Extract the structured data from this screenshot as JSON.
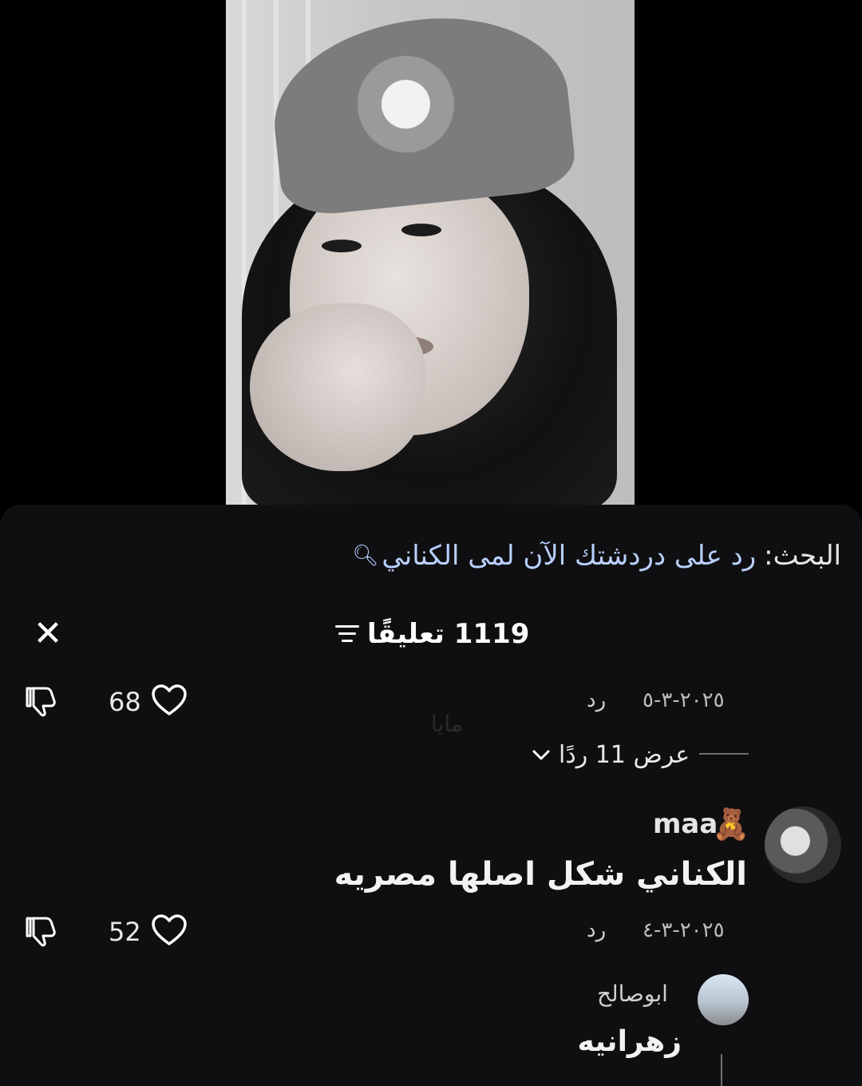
{
  "search": {
    "label": "البحث:",
    "query": "رد على دردشتك الآن لمى الكناني",
    "icon": "search-icon"
  },
  "header": {
    "comments_count": "1119 تعليقًا",
    "filter_icon": "filter-icon",
    "close_icon": "close-icon"
  },
  "comments": [
    {
      "likes": "68",
      "date": "٢٠٢٥-٣-٥",
      "reply_label": "رد",
      "view_replies": "عرض 11 ردًا"
    },
    {
      "username": "maa",
      "username_emoji": "🧸",
      "text": "الكناني شكل اصلها مصريه",
      "likes": "52",
      "date": "٢٠٢٥-٣-٤",
      "reply_label": "رد"
    },
    {
      "username": "ابوصالح",
      "text": "زهرانيه"
    }
  ],
  "watermark": "مايا",
  "colors": {
    "panel_bg": "#0f0f11",
    "search_query": "#b9cfff",
    "text_primary": "#f2f2f2",
    "text_secondary": "#bdbdbd"
  }
}
